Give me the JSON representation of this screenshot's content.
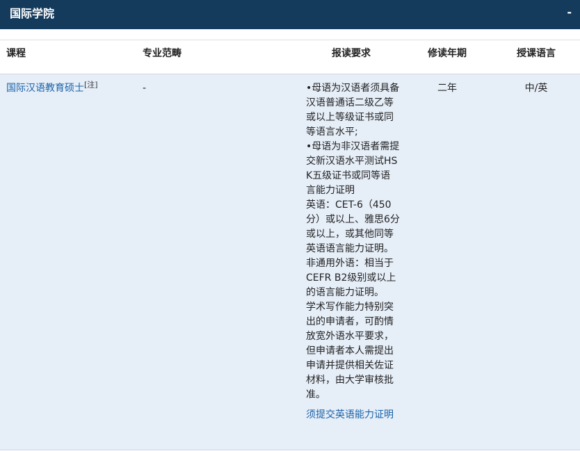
{
  "section": {
    "title": "国际学院",
    "collapse_symbol": "-"
  },
  "table": {
    "headers": [
      "课程",
      "专业范畴",
      "报读要求",
      "修读年期",
      "授课语言"
    ],
    "rows": [
      {
        "course": "国际汉语教育硕士",
        "note": "[注]",
        "category": "-",
        "requirements": "•母语为汉语者须具备汉语普通话二级乙等或以上等级证书或同等语言水平;\n•母语为非汉语者需提交新汉语水平测试HSK五级证书或同等语言能力证明\n英语：CET-6（450分）或以上、雅思6分或以上，或其他同等英语语言能力证明。非通用外语：相当于CEFR B2级别或以上的语言能力证明。\n学术写作能力特别突出的申请者，可酌情放宽外语水平要求，但申请者本人需提出申请并提供相关佐证材料，由大学审核批准。",
        "requirements_link": "须提交英语能力证明",
        "duration": "二年",
        "language": "中/英"
      }
    ]
  }
}
